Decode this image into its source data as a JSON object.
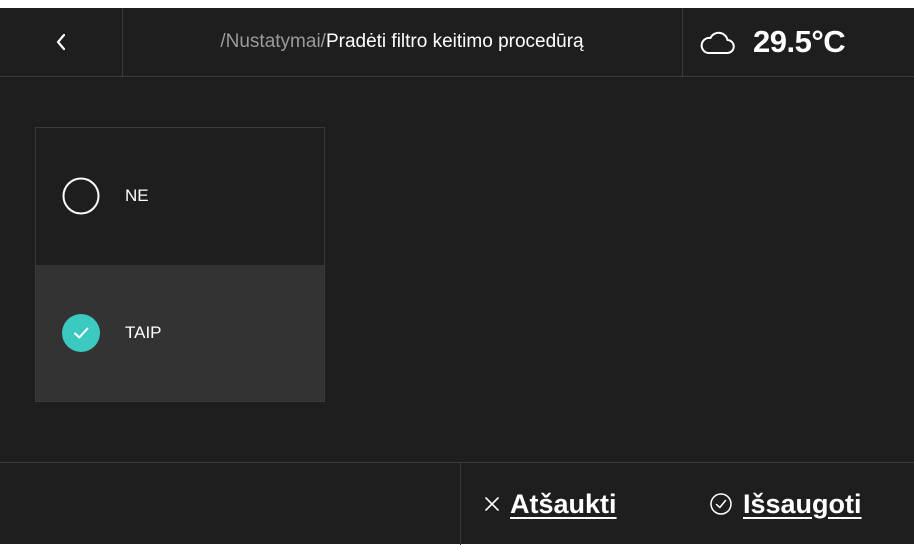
{
  "header": {
    "breadcrumb_parent": "/Nustatymai/",
    "breadcrumb_current": "Pradėti filtro keitimo procedūrą",
    "temperature": "29.5°C",
    "icons": {
      "back": "chevron-left-icon",
      "weather": "cloud-icon"
    }
  },
  "options": [
    {
      "label": "NE",
      "selected": false
    },
    {
      "label": "TAIP",
      "selected": true
    }
  ],
  "actions": {
    "cancel_label": "Atšaukti",
    "save_label": "Išsaugoti"
  },
  "colors": {
    "background": "#1e1e1e",
    "selected_row": "#333333",
    "accent": "#3cc9c0",
    "divider": "#3a3a3a"
  }
}
